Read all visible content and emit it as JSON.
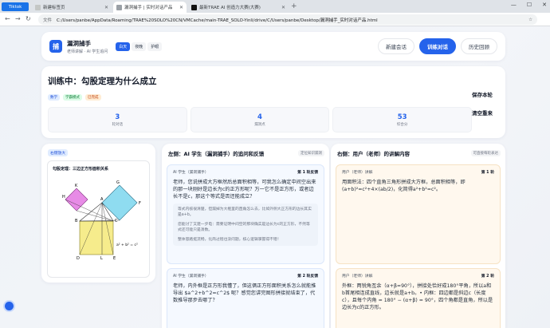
{
  "browser": {
    "app_tab": "Tiktok",
    "tabs": [
      {
        "title": "新建标签页",
        "active": false
      },
      {
        "title": "漏洞捕手 | 实时对话产品",
        "active": true
      },
      {
        "title": "最新TRAE AI 创造力大赛(大赛)",
        "active": false
      }
    ],
    "new_tab": "+",
    "doc_label": "文件",
    "url": "C:/Users/panbe/AppData/Roaming/TRAE%20SOLO%20CN/VMCache/main-TRAE_SOLO-Yinli/drive/C/Users/panbe/Desktop/漏洞捕手_实时对话产品.html"
  },
  "header": {
    "logo_char": "捕",
    "title": "漏洞捕手",
    "subtitle": "老师讲解 · AI 学生追问",
    "modes": [
      "白天",
      "夜晚",
      "护眼"
    ],
    "active_mode": 0,
    "nav": [
      "新建会话",
      "训练对话",
      "历史回顾"
    ],
    "active_nav": 1
  },
  "training": {
    "title": "训练中：勾股定理为什么成立",
    "chips": [
      "数学",
      "学霸模式",
      "已完成"
    ],
    "stats": [
      {
        "value": "3",
        "label": "轮对话"
      },
      {
        "value": "4",
        "label": "漏洞点"
      },
      {
        "value": "53",
        "label": "综合分"
      }
    ],
    "save_label": "保存本轮",
    "clear_label": "清空重来"
  },
  "figure": {
    "chip": "右键放大",
    "title": "勾股定理：三边正方形面积关系",
    "labels": {
      "H": "H",
      "K": "K",
      "G": "G",
      "F": "F",
      "A": "A",
      "B": "B",
      "C": "C",
      "D": "D",
      "L": "L",
      "E": "E",
      "formula": "a² + b² = c²"
    }
  },
  "left_panel": {
    "title": "左侧：AI 学生（漏洞捕手）的追问和反馈",
    "tag": "定位知识漏洞",
    "messages": [
      {
        "who": "AI 学生（漏洞捕手）",
        "round": "第 1 轮反馈",
        "text": "老师，您说拼成大方框然后总面积相等，可我怎么确定中间空出来的那一块刚好是边长为c的正方形呢？万一它不是正方形，或者边长不是c，那这个等式是否还能成立？",
        "hints": [
          "等式内核很清楚，但漏掉为大框里的直角怎么去，比如外侧大正方形的边长其实是a+b。",
          "您能讨了又建一步电：需要证明中间空的那块确实是边长为c的正方形，不然等式还可能只是凑数。",
          "整体思路挺流畅，化简过程也没问题，核心逻辑掌握得不错！"
        ]
      },
      {
        "who": "AI 学生（漏洞捕手）",
        "round": "第 2 轮反馈",
        "text": "老师，内外框是正方形我懂了，但这俩正方形面积关系怎么就能推导出 $a^2+b^2=c^2$ 呢？感觉您讲完图形拼接就结束了，代数推导那步去哪了？"
      }
    ]
  },
  "right_panel": {
    "title": "右侧：用户（老师）的讲解内容",
    "tag": "可直接每轮表达",
    "messages": [
      {
        "who": "用户（老师）讲解",
        "round": "第 1 轮",
        "text": "用面积法：四个直角三角形拼成大方框，总面积相等，即(a+b)²=c²+4×(ab/2)，化简得a²+b²=c²。"
      },
      {
        "who": "用户（老师）讲解",
        "round": "第 2 轮",
        "text": "外框：两锐角互余（α+β=90°），拼接处恰好成180°平角，所以a和b首尾相连成直线，边长就是a+b。• 内框：四边都是斜边c（长度c），且每个内角 = 180° − (α+β) = 90°，四个角都是直角，所以是边长为c的正方形。"
      }
    ]
  },
  "colors": {
    "accent": "#2563eb",
    "bg": "#eef2f7"
  }
}
